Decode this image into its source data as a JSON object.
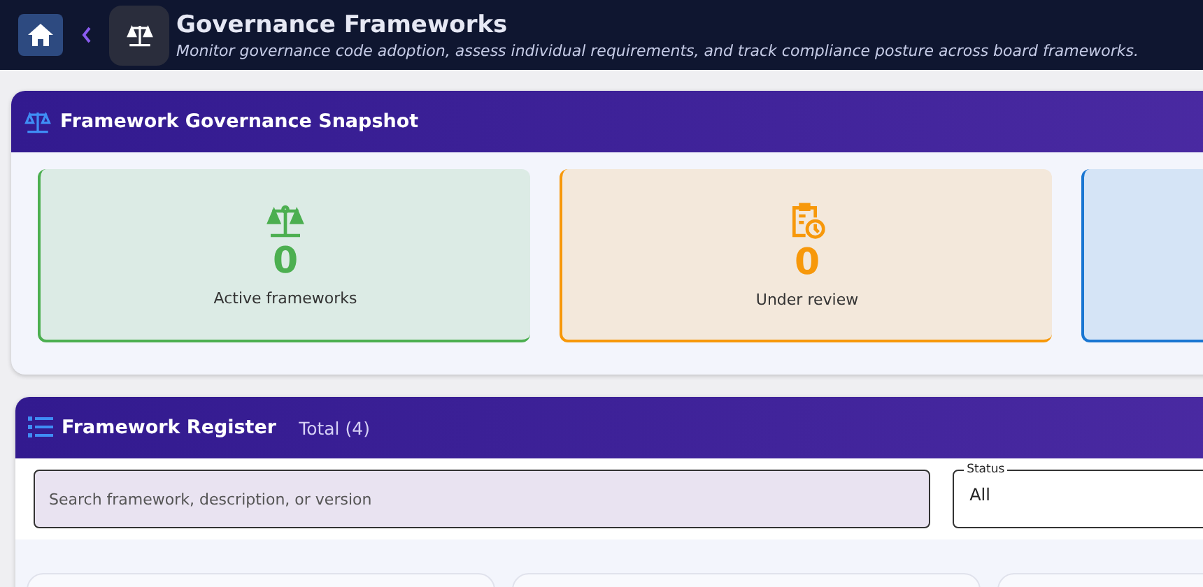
{
  "header": {
    "title": "Governance Frameworks",
    "subtitle": "Monitor governance code adoption, assess individual requirements, and track compliance posture across board frameworks."
  },
  "snapshot": {
    "title": "Framework Governance Snapshot",
    "stats": [
      {
        "kind": "scales",
        "value": "0",
        "label": "Active frameworks",
        "color": "#4caf50"
      },
      {
        "kind": "review",
        "value": "0",
        "label": "Under review",
        "color": "#f7980a"
      },
      {
        "kind": "other",
        "color": "#1976d2"
      }
    ]
  },
  "register": {
    "title": "Framework Register",
    "total": "Total (4)",
    "search": {
      "placeholder": "Search framework, description, or version"
    },
    "status": {
      "label": "Status",
      "value": "All"
    }
  }
}
